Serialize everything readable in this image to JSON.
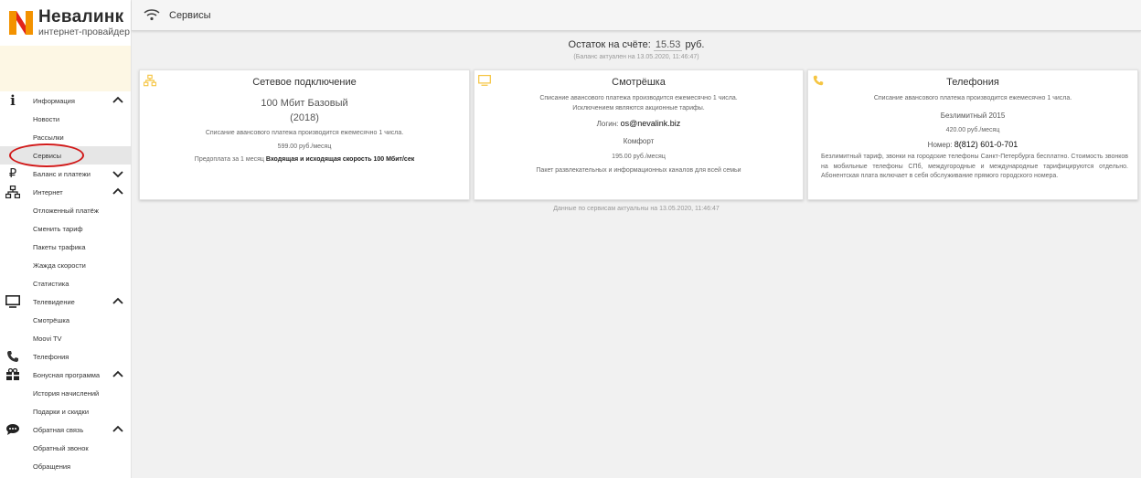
{
  "brand": {
    "name": "Невалинк",
    "tagline": "интернет-провайдер",
    "colors": {
      "orange": "#f39200",
      "red": "#e2231a",
      "accent_yellow": "#f5c542"
    }
  },
  "header": {
    "title": "Сервисы",
    "icon": "wifi-icon"
  },
  "sidebar": {
    "sections": [
      {
        "label": "Информация",
        "icon": "info-icon",
        "expanded": true,
        "items": [
          "Новости",
          "Рассылки",
          "Сервисы"
        ]
      },
      {
        "label": "Баланс и платежи",
        "icon": "ruble-icon",
        "expanded": false,
        "items": []
      },
      {
        "label": "Интернет",
        "icon": "network-icon",
        "expanded": true,
        "items": [
          "Отложенный платёж",
          "Сменить тариф",
          "Пакеты трафика",
          "Жажда скорости",
          "Статистика"
        ]
      },
      {
        "label": "Телевидение",
        "icon": "tv-icon",
        "expanded": true,
        "items": [
          "Смотрёшка",
          "Moovi TV"
        ]
      },
      {
        "label": "Телефония",
        "icon": "phone-icon",
        "expanded": null,
        "items": []
      },
      {
        "label": "Бонусная программа",
        "icon": "gift-icon",
        "expanded": true,
        "items": [
          "История начислений",
          "Подарки и скидки"
        ]
      },
      {
        "label": "Обратная связь",
        "icon": "chat-icon",
        "expanded": true,
        "items": [
          "Обратный звонок",
          "Обращения"
        ]
      }
    ],
    "active_item": "Сервисы"
  },
  "balance": {
    "label": "Остаток на счёте:",
    "amount": "15.53",
    "currency": "руб.",
    "updated": "(Баланс актуален на 13.05.2020, 11:46:47)"
  },
  "cards": {
    "internet": {
      "title": "Сетевое подключение",
      "tariff": "100 Мбит Базовый",
      "year": "(2018)",
      "note": "Списание авансового платежа производится ежемесячно 1 числа.",
      "price": "599.00 руб./месяц",
      "prepay_label": "Предоплата за 1 месяц",
      "prepay_value": "Входящая и исходящая скорость 100 Мбит/сек"
    },
    "tv": {
      "title": "Смотрёшка",
      "note1": "Списание авансового платежа производится ежемесячно 1 числа.",
      "note2": "Исключением являются акционные тарифы.",
      "login_label": "Логин:",
      "login_value": "os@nevalink.biz",
      "tariff": "Комфорт",
      "price": "195.00 руб./месяц",
      "desc": "Пакет развлекательных и информационных каналов для всей семьи"
    },
    "phone": {
      "title": "Телефония",
      "note": "Списание авансового платежа производится ежемесячно 1 числа.",
      "tariff": "Безлимитный 2015",
      "price": "420.00 руб./месяц",
      "number_label": "Номер:",
      "number_value": "8(812) 601-0-701",
      "desc": "Безлимитный тариф, звонки на городские телефоны Санкт-Петербурга бесплатно. Стоимость звонков на мобильные телефоны СПб, междугородные и международные тарифицируются отдельно. Абонентская плата включает в себя обслуживание прямого городского номера."
    }
  },
  "footer_note": "Данные по сервисам актуальны на 13.05.2020, 11:46:47"
}
